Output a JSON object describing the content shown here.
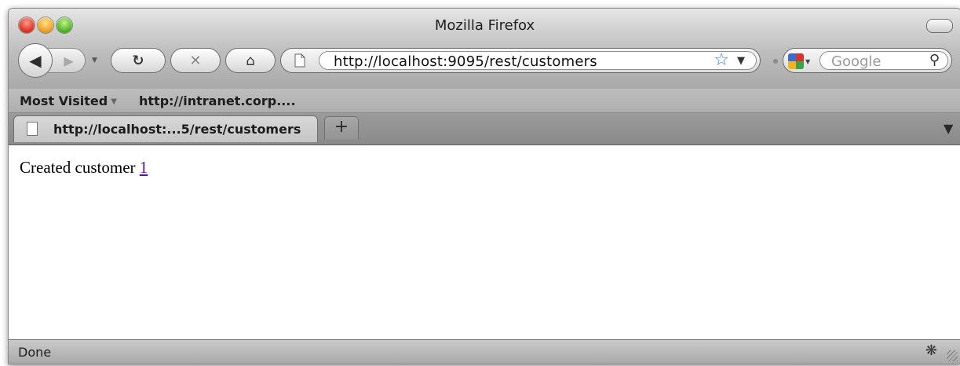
{
  "window": {
    "title": "Mozilla Firefox"
  },
  "toolbar": {
    "back_icon": "back-arrow-icon",
    "forward_icon": "forward-arrow-icon",
    "reload_icon": "reload-icon",
    "stop_icon": "stop-icon",
    "home_icon": "home-icon",
    "url": "http://localhost:9095/rest/customers",
    "search_placeholder": "Google"
  },
  "bookmarks": {
    "items": [
      {
        "label": "Most Visited"
      },
      {
        "label": "http://intranet.corp...."
      }
    ]
  },
  "tabs": [
    {
      "label": "http://localhost:...5/rest/customers",
      "active": true
    }
  ],
  "content": {
    "text": "Created customer ",
    "link_text": "1"
  },
  "status": {
    "text": "Done"
  },
  "colors": {
    "link": "#551a8b",
    "star": "#3d78c9"
  }
}
